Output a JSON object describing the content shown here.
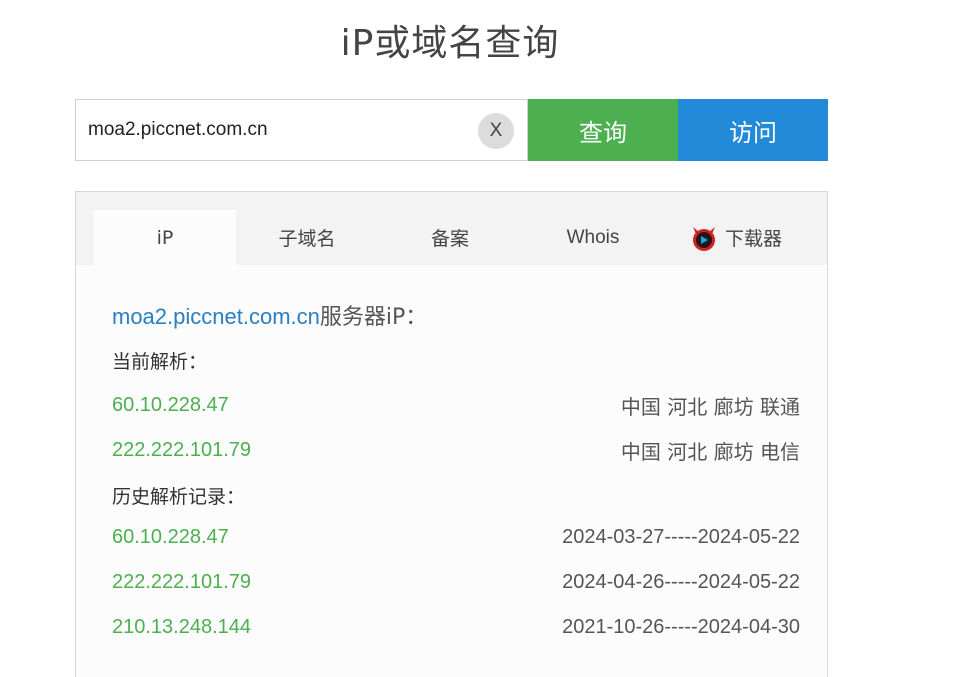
{
  "title": "iP或域名查询",
  "search": {
    "value": "moa2.piccnet.com.cn",
    "clear_label": "X",
    "query_label": "查询",
    "visit_label": "访问"
  },
  "tabs": [
    {
      "label": "iP",
      "active": true
    },
    {
      "label": "子域名"
    },
    {
      "label": "备案"
    },
    {
      "label": "Whois"
    },
    {
      "label": "下载器",
      "icon": "devil-icon"
    }
  ],
  "result": {
    "domain": "moa2.piccnet.com.cn",
    "suffix": "服务器iP：",
    "current_label": "当前解析：",
    "current": [
      {
        "ip": "60.10.228.47",
        "location": "中国 河北 廊坊 联通"
      },
      {
        "ip": "222.222.101.79",
        "location": "中国 河北 廊坊 电信"
      }
    ],
    "history_label": "历史解析记录：",
    "history": [
      {
        "ip": "60.10.228.47",
        "range": "2024-03-27-----2024-05-22"
      },
      {
        "ip": "222.222.101.79",
        "range": "2024-04-26-----2024-05-22"
      },
      {
        "ip": "210.13.248.144",
        "range": "2021-10-26-----2024-04-30"
      }
    ]
  },
  "colors": {
    "query_button": "#4caf50",
    "visit_button": "#2389d9",
    "ip_green": "#4caf50",
    "domain_blue": "#2b7fc1"
  }
}
